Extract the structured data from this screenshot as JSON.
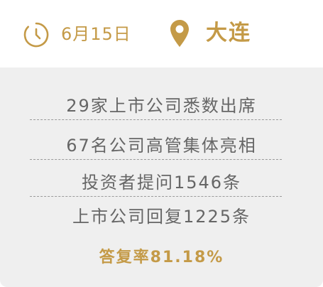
{
  "header": {
    "date": "6月15日",
    "city": "大连"
  },
  "stats": {
    "companies_attending": "29家上市公司悉数出席",
    "executives": "67名公司高管集体亮相",
    "questions": "投资者提问1546条",
    "replies": "上市公司回复1225条",
    "reply_rate": "答复率81.18%"
  },
  "icons": {
    "clock": "clock-icon",
    "location": "location-pin-icon"
  },
  "colors": {
    "accent": "#c49a47",
    "panel_background": "#efefef",
    "text": "#666666"
  }
}
